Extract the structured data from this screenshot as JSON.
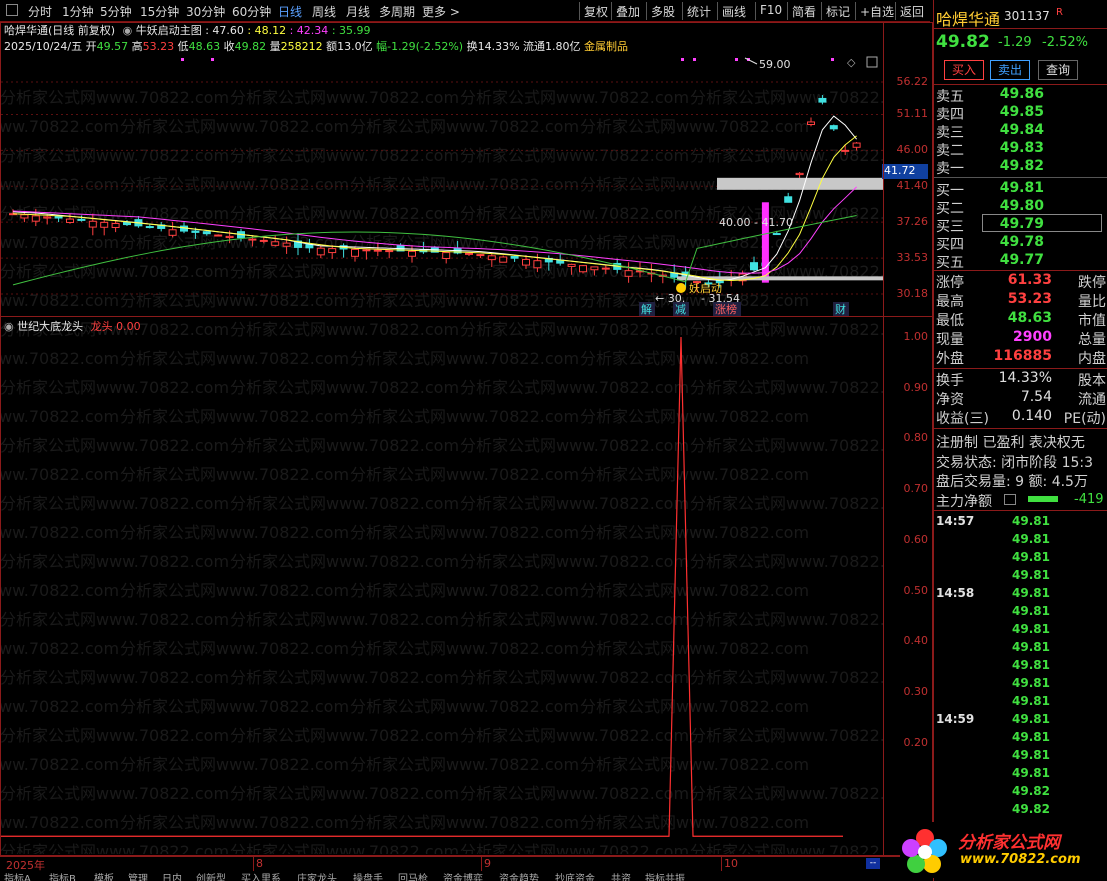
{
  "toolbar": {
    "periods": [
      "分时",
      "1分钟",
      "5分钟",
      "15分钟",
      "30分钟",
      "60分钟",
      "日线",
      "周线",
      "月线",
      "多周期",
      "更多 >"
    ],
    "active": "日线",
    "tools": [
      "复权",
      "叠加",
      "多股",
      "统计",
      "画线",
      "F10",
      "简看",
      "标记",
      "+自选",
      "返回"
    ]
  },
  "info": {
    "stock": "哈焊华通",
    "mode": "(日线 前复权)",
    "indicator_name": "牛妖启动主图",
    "ind_values": [
      ": 47.60",
      ": 48.12",
      ": 42.34",
      ": 35.99"
    ],
    "date": "2025/10/24/五",
    "open_l": "开",
    "open": "49.57",
    "high_l": "高",
    "high": "53.23",
    "low_l": "低",
    "low": "48.63",
    "close_l": "收",
    "close": "49.82",
    "vol_l": "量",
    "vol": "258212",
    "amt": "额13.0亿",
    "chg": "幅-1.29(-2.52%)",
    "turnover": "换14.33%",
    "float": "流通1.80亿",
    "sector": "金属制品"
  },
  "main_axis": [
    "56.22",
    "51.11",
    "46.00",
    "41.40",
    "37.26",
    "33.53",
    "30.18"
  ],
  "current_price_tag": "41.72",
  "annotations": {
    "peak": "59.00",
    "box": "40.00 - 41.70",
    "low": "- 31.54",
    "low_prefix": "← 30.",
    "start": "妖启动",
    "tags": [
      "解",
      "减",
      "涨榜",
      "财"
    ]
  },
  "indicator": {
    "name": "世纪大底龙头",
    "label": "龙头",
    "value": "0.00",
    "axis": [
      "1.00",
      "0.90",
      "0.80",
      "0.70",
      "0.60",
      "0.50",
      "0.40",
      "0.30",
      "0.20"
    ]
  },
  "timeline": [
    "2025年",
    "8",
    "9",
    "10"
  ],
  "bottom_tabs": [
    "指标A",
    "指标B",
    "模板",
    "管理",
    "日内",
    "创新型",
    "买入里系",
    "庄家龙头",
    "操盘手",
    "回马枪",
    "资金博弈",
    "资金趋势",
    "抄底资金",
    "共资",
    "指标共振"
  ],
  "quote": {
    "name": "哈焊华通",
    "code": "301137",
    "code_tag": "R",
    "price": "49.82",
    "change": "-1.29",
    "pct": "-2.52%",
    "buy_btn": "买入",
    "sell_btn": "卖出",
    "query_btn": "查询",
    "asks": [
      [
        "卖五",
        "49.86"
      ],
      [
        "卖四",
        "49.85"
      ],
      [
        "卖三",
        "49.84"
      ],
      [
        "卖二",
        "49.83"
      ],
      [
        "卖一",
        "49.82"
      ]
    ],
    "bids": [
      [
        "买一",
        "49.81"
      ],
      [
        "买二",
        "49.80"
      ],
      [
        "买三",
        "49.79"
      ],
      [
        "买四",
        "49.78"
      ],
      [
        "买五",
        "49.77"
      ]
    ],
    "stats": [
      [
        "涨停",
        "61.33",
        "跌停"
      ],
      [
        "最高",
        "53.23",
        "量比"
      ],
      [
        "最低",
        "48.63",
        "市值"
      ],
      [
        "现量",
        "2900",
        "总量"
      ],
      [
        "外盘",
        "116885",
        "内盘"
      ]
    ],
    "stats2": [
      [
        "换手",
        "14.33%",
        "股本"
      ],
      [
        "净资",
        "7.54",
        "流通"
      ],
      [
        "收益(三)",
        "0.140",
        "PE(动)"
      ]
    ],
    "reg": "注册制 已盈利 表决权无",
    "trade_state": "交易状态: 闭市阶段 15:3",
    "after_hours": "盘后交易量: 9  额: 4.5万",
    "main_flow_label": "主力净额",
    "main_flow_value": "-419",
    "ticks": [
      {
        "time": "14:57",
        "vals": [
          "49.81",
          "49.81",
          "49.81",
          "49.81"
        ]
      },
      {
        "time": "14:58",
        "vals": [
          "49.81",
          "49.81",
          "49.81",
          "49.81",
          "49.81",
          "49.81",
          "49.81"
        ]
      },
      {
        "time": "14:59",
        "vals": [
          "49.81",
          "49.81",
          "49.81",
          "49.81",
          "49.82",
          "49.82"
        ]
      }
    ]
  },
  "logo": {
    "text": "分析家公式网",
    "url": "www.70822.com"
  },
  "watermark": "分析家公式网www.70822.com",
  "colors": {
    "up": "#ff4040",
    "down": "#40e0e0",
    "ma5": "#ffffff",
    "ma10": "#ffff40",
    "ma20": "#ff40ff",
    "ma60": "#40c040",
    "frame": "#8b1a1a"
  },
  "chart_data": {
    "type": "line",
    "title": "世纪大底龙头",
    "series": [
      {
        "name": "龙头",
        "spike_value": 1.0,
        "baseline": 0.0
      }
    ],
    "ylim": [
      0,
      1.05
    ]
  }
}
